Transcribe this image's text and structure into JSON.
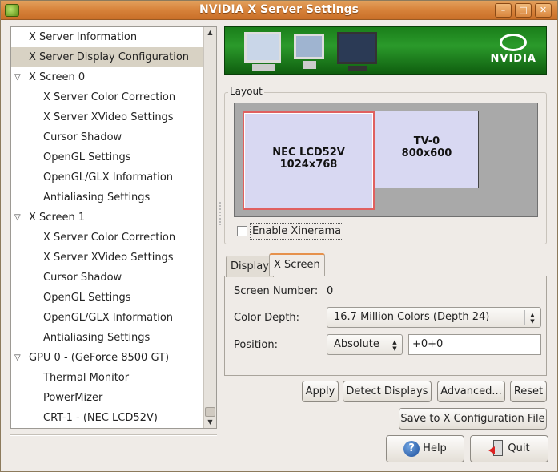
{
  "window": {
    "title": "NVIDIA X Server Settings",
    "minimize": "–",
    "maximize": "□",
    "close": "✕"
  },
  "tree": {
    "items": [
      {
        "label": "X Server Information",
        "level": 0
      },
      {
        "label": "X Server Display Configuration",
        "level": 0,
        "selected": true
      },
      {
        "label": "X Screen 0",
        "level": 0,
        "expander": "▽"
      },
      {
        "label": "X Server Color Correction",
        "level": 1
      },
      {
        "label": "X Server XVideo Settings",
        "level": 1
      },
      {
        "label": "Cursor Shadow",
        "level": 1
      },
      {
        "label": "OpenGL Settings",
        "level": 1
      },
      {
        "label": "OpenGL/GLX Information",
        "level": 1
      },
      {
        "label": "Antialiasing Settings",
        "level": 1
      },
      {
        "label": "X Screen 1",
        "level": 0,
        "expander": "▽"
      },
      {
        "label": "X Server Color Correction",
        "level": 1
      },
      {
        "label": "X Server XVideo Settings",
        "level": 1
      },
      {
        "label": "Cursor Shadow",
        "level": 1
      },
      {
        "label": "OpenGL Settings",
        "level": 1
      },
      {
        "label": "OpenGL/GLX Information",
        "level": 1
      },
      {
        "label": "Antialiasing Settings",
        "level": 1
      },
      {
        "label": "GPU 0 - (GeForce 8500 GT)",
        "level": 0,
        "expander": "▽"
      },
      {
        "label": "Thermal Monitor",
        "level": 1
      },
      {
        "label": "PowerMizer",
        "level": 1
      },
      {
        "label": "CRT-1 - (NEC LCD52V)",
        "level": 1
      }
    ],
    "scroll_up": "▲",
    "scroll_down": "▼"
  },
  "banner": {
    "logo_text": "NVIDIA",
    "colors": {
      "green": "#2b9a2b"
    }
  },
  "layout": {
    "label": "Layout",
    "screens": [
      {
        "name": "NEC LCD52V",
        "resolution": "1024x768",
        "active": true
      },
      {
        "name": "TV-0",
        "resolution": "800x600",
        "active": false
      }
    ],
    "xinerama_label": "Enable Xinerama",
    "xinerama_checked": false
  },
  "tabs": [
    {
      "label": "Display",
      "active": false
    },
    {
      "label": "X Screen",
      "active": true
    }
  ],
  "xscreen": {
    "screen_number_label": "Screen Number:",
    "screen_number_value": "0",
    "color_depth_label": "Color Depth:",
    "color_depth_value": "16.7 Million Colors (Depth 24)",
    "position_label": "Position:",
    "position_mode": "Absolute",
    "position_value": "+0+0"
  },
  "buttons": {
    "apply": "Apply",
    "detect": "Detect Displays",
    "advanced": "Advanced...",
    "reset": "Reset",
    "save": "Save to X Configuration File",
    "help": "Help",
    "quit": "Quit"
  }
}
